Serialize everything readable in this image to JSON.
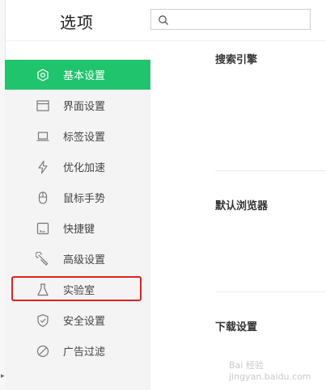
{
  "header": {
    "title": "选项",
    "search": {
      "placeholder": "",
      "value": ""
    }
  },
  "sidebar": {
    "items": [
      {
        "label": "基本设置",
        "icon": "settings-icon",
        "active": true
      },
      {
        "label": "界面设置",
        "icon": "window-icon",
        "active": false
      },
      {
        "label": "标签设置",
        "icon": "laptop-icon",
        "active": false
      },
      {
        "label": "优化加速",
        "icon": "lightning-icon",
        "active": false
      },
      {
        "label": "鼠标手势",
        "icon": "mouse-icon",
        "active": false
      },
      {
        "label": "快捷键",
        "icon": "keyboard-icon",
        "active": false
      },
      {
        "label": "高级设置",
        "icon": "wrench-icon",
        "active": false
      },
      {
        "label": "实验室",
        "icon": "flask-icon",
        "active": false,
        "highlighted": true
      },
      {
        "label": "安全设置",
        "icon": "shield-icon",
        "active": false
      },
      {
        "label": "广告过滤",
        "icon": "ban-icon",
        "active": false
      }
    ]
  },
  "main": {
    "sections": [
      {
        "title": "搜索引擎"
      },
      {
        "title": "默认浏览器"
      },
      {
        "title": "下载设置"
      }
    ]
  },
  "watermark": {
    "text": "Bai 经验 jingyan.baidu.com"
  },
  "colors": {
    "accent": "#1fc46c",
    "highlight_border": "#e02020"
  }
}
